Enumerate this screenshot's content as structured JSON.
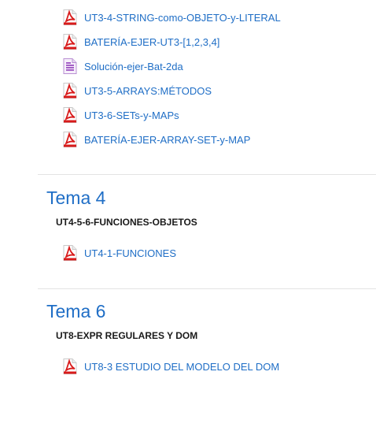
{
  "section_ut3": {
    "items": [
      {
        "label": "UT3-4-STRING-como-OBJETO-y-LITERAL",
        "icon": "pdf-icon"
      },
      {
        "label": "BATERÍA-EJER-UT3-[1,2,3,4]",
        "icon": "pdf-icon"
      },
      {
        "label": "Solución-ejer-Bat-2da",
        "icon": "document-icon"
      },
      {
        "label": "UT3-5-ARRAYS:MÉTODOS",
        "icon": "pdf-icon"
      },
      {
        "label": "UT3-6-SETs-y-MAPs",
        "icon": "pdf-icon"
      },
      {
        "label": "BATERÍA-EJER-ARRAY-SET-y-MAP",
        "icon": "pdf-icon"
      }
    ]
  },
  "section_tema4": {
    "title": "Tema 4",
    "summary": "UT4-5-6-FUNCIONES-OBJETOS",
    "items": [
      {
        "label": "UT4-1-FUNCIONES",
        "icon": "pdf-icon"
      }
    ]
  },
  "section_tema6": {
    "title": "Tema 6",
    "summary": "UT8-EXPR REGULARES Y DOM",
    "items": [
      {
        "label": "UT8-3 ESTUDIO DEL MODELO DEL DOM",
        "icon": "pdf-icon"
      }
    ]
  },
  "colors": {
    "link": "#1f6ec6",
    "pdf_red": "#d81b1b",
    "doc_purple": "#9c4fc1",
    "divider": "#e3e3e3"
  }
}
